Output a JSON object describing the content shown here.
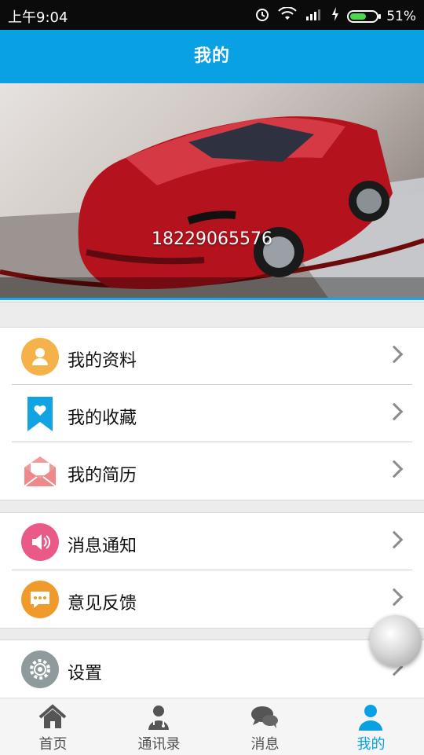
{
  "status_bar": {
    "time": "上午9:04",
    "battery": "51%"
  },
  "app_bar": {
    "title": "我的"
  },
  "profile": {
    "phone": "18229065576"
  },
  "menu_groups": [
    {
      "items": [
        {
          "label": "我的资料",
          "icon": "person-icon",
          "color": "#f6b24a"
        },
        {
          "label": "我的收藏",
          "icon": "bookmark-heart-icon",
          "color": "#12a3e2"
        },
        {
          "label": "我的简历",
          "icon": "envelope-icon",
          "color": "#f29a9a"
        }
      ]
    },
    {
      "items": [
        {
          "label": "消息通知",
          "icon": "speaker-icon",
          "color": "#ea5a86"
        },
        {
          "label": "意见反馈",
          "icon": "chat-bubble-icon",
          "color": "#ef9b2c"
        }
      ]
    },
    {
      "items": [
        {
          "label": "设置",
          "icon": "gear-icon",
          "color": "#8f9a9c"
        }
      ]
    }
  ],
  "tabs": [
    {
      "label": "首页",
      "icon": "home-icon",
      "active": false
    },
    {
      "label": "通讯录",
      "icon": "contacts-icon",
      "active": false
    },
    {
      "label": "消息",
      "icon": "chat-icon",
      "active": false
    },
    {
      "label": "我的",
      "icon": "user-icon",
      "active": true
    }
  ],
  "colors": {
    "primary": "#0aa0e4",
    "background": "#efefef"
  }
}
